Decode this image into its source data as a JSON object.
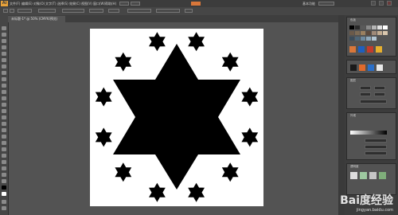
{
  "app": {
    "logo_text": "Ai"
  },
  "menubar": {
    "items": [
      "文件(F)",
      "编辑(E)",
      "对象(O)",
      "文字(T)",
      "选择(S)",
      "效果(C)",
      "视图(V)",
      "窗口(W)",
      "帮助(H)"
    ],
    "workspace_label": "基本功能"
  },
  "document": {
    "tab_label": "未标题-1* @ 50% (CMYK/预览)"
  },
  "panels": {
    "color_title": "色板",
    "layers_title": "图层",
    "appearance_title": "外观",
    "transparency_title": "透明度"
  },
  "watermark": {
    "logo": "Bai度经验",
    "url": "jingyan.baidu.com"
  },
  "colors": {
    "accent": "#d9773a",
    "ui_dark": "#3c3c3c",
    "ui_mid": "#535353",
    "artboard": "#ffffff",
    "shape_fill": "#000000"
  },
  "shapes": {
    "large_star": "six-point star",
    "small_stars": 12
  }
}
